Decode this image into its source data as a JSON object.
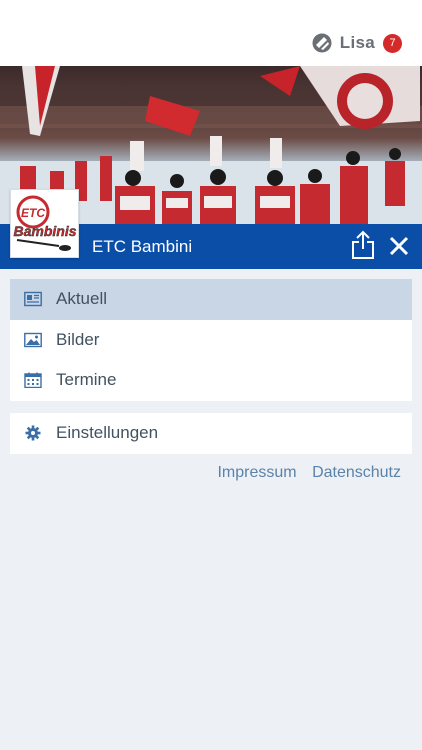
{
  "header": {
    "user_name": "Lisa",
    "notification_count": "7",
    "brand_icon": "app-logo-icon"
  },
  "club": {
    "name": "ETC Bambini",
    "logo_text": "ETC Bambinis"
  },
  "menu_main": [
    {
      "label": "Aktuell",
      "icon": "news-icon",
      "active": true
    },
    {
      "label": "Bilder",
      "icon": "image-icon",
      "active": false
    },
    {
      "label": "Termine",
      "icon": "calendar-icon",
      "active": false
    }
  ],
  "menu_settings": {
    "label": "Einstellungen",
    "icon": "gear-icon"
  },
  "footer": {
    "impressum": "Impressum",
    "datenschutz": "Datenschutz"
  },
  "colors": {
    "club_bar": "#0a4ea8",
    "active_item": "#c9d6e6",
    "background": "#edf1f6",
    "badge": "#d42a2a",
    "link": "#5b82a8"
  }
}
